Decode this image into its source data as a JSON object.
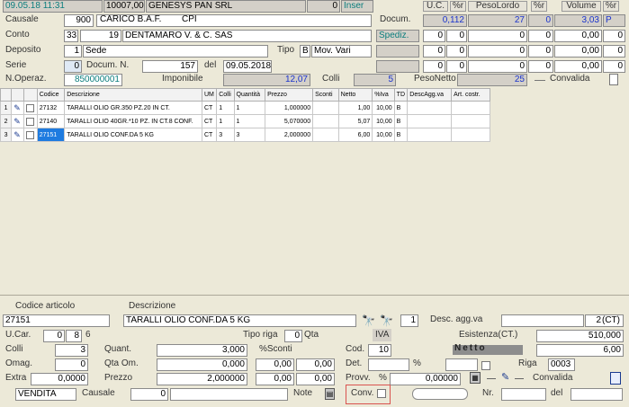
{
  "header": {
    "datetime": "09.05.18 11:31",
    "supplier_code": "10007,00",
    "supplier_name": "GENESYS PAN SRL",
    "counter": "0",
    "mode": "Inser",
    "col_uc": "U.C.",
    "col_pr1": "%r",
    "col_pesolordo": "PesoLordo",
    "col_pr2": "%r",
    "col_volume": "Volume",
    "col_pr3": "%r"
  },
  "doc": {
    "causale_label": "Causale",
    "causale_code": "900",
    "causale_desc": "CARICO B.A.F.",
    "causale_type": "CPI",
    "conto_label": "Conto",
    "conto_a": "33",
    "conto_b": "19",
    "conto_name": "DENTAMARO V. & C. SAS",
    "deposito_label": "Deposito",
    "deposito_code": "1",
    "deposito_name": "Sede",
    "tipo_label": "Tipo",
    "tipo_code": "B",
    "tipo_desc": "Mov. Vari",
    "serie_label": "Serie",
    "serie_value": "0",
    "docum_n_label": "Docum. N.",
    "docum_n_value": "157",
    "del_label": "del",
    "del_value": "09.05.2018",
    "noperaz_label": "N.Operaz.",
    "noperaz_value": "850000001",
    "imponibile_label": "Imponibile",
    "imponibile_value": "12,07",
    "colli_label": "Colli",
    "colli_value": "5",
    "pesonetto_label": "PesoNetto",
    "pesonetto_value": "25",
    "convalida_label": "Convalida",
    "docum_label": "Docum.",
    "docum_uc": "0,112",
    "docum_pr1": "27",
    "docum_pesolordo": "0",
    "docum_pr2": "3,03",
    "docum_volume": "P",
    "spediz_label": "Spediz.",
    "zero": "0",
    "zero2": "0,00"
  },
  "grid": {
    "headers": [
      "Codice",
      "Descrizione",
      "UM",
      "Colli",
      "Quantità",
      "Prezzo",
      "Sconti",
      "Netto",
      "%Iva",
      "TD",
      "DescAgg.va",
      "Art. costr."
    ],
    "rows": [
      {
        "n": "1",
        "codice": "27132",
        "desc": "TARALLI OLIO GR.350 PZ.20 IN CT.",
        "um": "CT",
        "colli": "1",
        "qta": "1",
        "prezzo": "1,000000",
        "sconti": "",
        "netto": "1,00",
        "iva": "10,00",
        "td": "B"
      },
      {
        "n": "2",
        "codice": "27140",
        "desc": "TARALLI OLIO 40GR.*10 PZ. IN CT.8 CONF.",
        "um": "CT",
        "colli": "1",
        "qta": "1",
        "prezzo": "5,070000",
        "sconti": "",
        "netto": "5,07",
        "iva": "10,00",
        "td": "B"
      },
      {
        "n": "3",
        "codice": "27151",
        "desc": "TARALLI OLIO CONF.DA 5 KG",
        "um": "CT",
        "colli": "3",
        "qta": "3",
        "prezzo": "2,000000",
        "sconti": "",
        "netto": "6,00",
        "iva": "10,00",
        "td": "B"
      }
    ]
  },
  "detail": {
    "codice_label": "Codice articolo",
    "descr_label": "Descrizione",
    "codice_value": "27151",
    "descr_value": "TARALLI OLIO CONF.DA 5 KG",
    "counter": "1",
    "descagg_label": "Desc. agg.va",
    "um_num": "2",
    "um_value": "(CT)",
    "ucar_label": "U.Car.",
    "ucar_a": "0",
    "ucar_b": "8",
    "ucar_c": "6",
    "tiporiga_label": "Tipo riga",
    "tiporiga_value": "0",
    "qta_label": "Qta",
    "iva_label": "IVA",
    "esistenza_label": "Esistenza(",
    "esistenza_unit": "CT.)",
    "esistenza_value": "510,000",
    "colli_label": "Colli",
    "colli_value": "3",
    "quant_label": "Quant.",
    "quant_value": "3,000",
    "sconti_label": "%Sconti",
    "cod_label": "Cod.",
    "cod_value": "10",
    "netto_label": "Netto",
    "netto_value": "6,00",
    "omag_label": "Omag.",
    "omag_value": "0",
    "qtaom_label": "Qta Om.",
    "qtaom_value": "0,000",
    "det_label": "Det.",
    "pct": "%",
    "riga_label": "Riga",
    "riga_value": "0003",
    "extra_label": "Extra",
    "extra_value": "0,0000",
    "prezzo_label": "Prezzo",
    "prezzo_value": "2,000000",
    "provv_label": "Provv.",
    "provv_value": "0,00000",
    "zero00": "0,00",
    "zero": "0",
    "vendita_value": "VENDITA",
    "causale_label": "Causale",
    "causale_value": "0",
    "note_label": "Note",
    "conv_label": "Conv.",
    "nr_label": "Nr.",
    "del_label": "del",
    "convalida_label": "Convalida"
  }
}
